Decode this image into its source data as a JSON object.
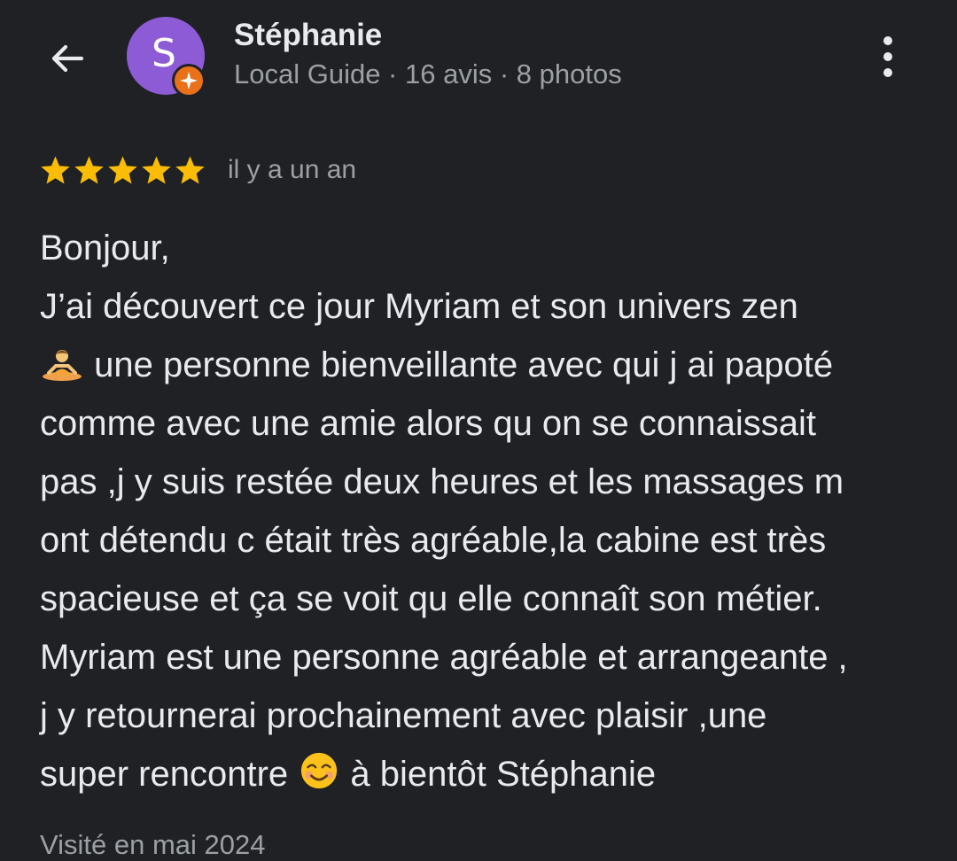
{
  "header": {
    "back_icon": "arrow-left-icon",
    "avatar_letter": "S",
    "badge_icon": "local-guide-badge-icon",
    "reviewer_name": "Stéphanie",
    "reviewer_meta": "Local Guide · 16 avis · 8 photos",
    "menu_icon": "more-vert-icon"
  },
  "review": {
    "rating": 5,
    "max_rating": 5,
    "star_color": "#fbbc04",
    "time_ago": "il y a un an",
    "lines": [
      "Bonjour,",
      "J’ai découvert ce jour Myriam et son univers zen",
      " une personne bienveillante avec qui j ai papoté",
      "comme avec une amie alors qu on se connaissait",
      "pas ,j y suis restée deux heures et les massages m",
      "ont détendu c était très agréable,la cabine est très",
      "spacieuse et ça se voit qu elle connaît son métier.",
      "Myriam est une personne agréable et arrangeante ,",
      "j y retournerai prochainement avec plaisir ,une",
      "super rencontre ",
      " à bientôt Stéphanie"
    ],
    "emoji_meditation": "person-in-lotus-position-emoji",
    "emoji_smile": "smiling-face-emoji",
    "visited": "Visité en mai 2024"
  },
  "colors": {
    "background": "#202124",
    "primary_text": "#e8eaed",
    "secondary_text": "#9aa0a6",
    "avatar": "#8e5bd6",
    "badge": "#e8711a"
  }
}
